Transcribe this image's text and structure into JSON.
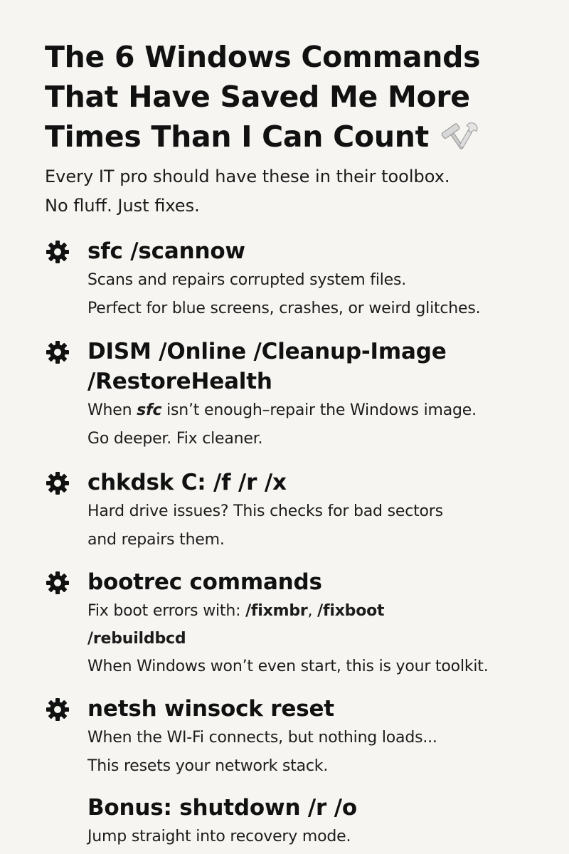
{
  "title": {
    "line1": "The 6 Windows Commands",
    "line2": "That Have Saved Me More",
    "line3": "Times Than I Can Count",
    "icon": "tools-icon"
  },
  "subtitle": {
    "line1": "Every IT pro should have these in their toolbox.",
    "line2": "No fluff. Just fixes."
  },
  "items": [
    {
      "icon": "gear-icon",
      "command": "sfc /scannow",
      "desc_line1": "Scans and repairs corrupted system files.",
      "desc_line2": "Perfect for blue screens, crashes, or weird glitches."
    },
    {
      "icon": "gear-icon",
      "command_line1": "DISM /Online /Cleanup-Image",
      "command_line2": "/RestoreHealth",
      "desc_pre": "When ",
      "desc_em": "sfc",
      "desc_post": " isn’t enough–repair the Windows image.",
      "desc_line2": "Go deeper. Fix cleaner."
    },
    {
      "icon": "gear-icon",
      "command": "chkdsk C: /f /r /x",
      "desc_line1": "Hard drive issues? This checks for bad sectors",
      "desc_line2": "and repairs them."
    },
    {
      "icon": "gear-icon",
      "command": "bootrec commands",
      "desc_pre": "Fix boot errors with: ",
      "desc_b1": "/fixmbr",
      "desc_sep": ", ",
      "desc_b2": "/fixboot",
      "desc_b3": "/rebuildbcd",
      "desc_line3": "When Windows won’t even start, this is your toolkit."
    },
    {
      "icon": "gear-icon",
      "command": "netsh winsock reset",
      "desc_line1": "When the WI-Fi connects, but nothing loads...",
      "desc_line2": "This resets your network stack."
    }
  ],
  "bonus": {
    "command": "Bonus: shutdown /r /o",
    "desc_line1": "Jump straight into recovery mode."
  }
}
